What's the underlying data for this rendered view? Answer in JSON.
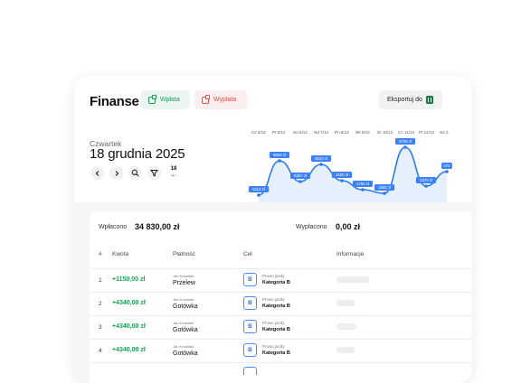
{
  "header": {
    "app_title": "Finanse",
    "btn_in": "Wpłata",
    "btn_out": "Wypłata",
    "btn_export": "Eksportuj do",
    "export_icon": "excel-icon"
  },
  "date_block": {
    "weekday": "Czwartek",
    "date": "18 grudnia 2025",
    "calendar_day": "18",
    "calendar_sub": "gru"
  },
  "controls": {
    "prev_icon": "chevron-left-icon",
    "next_icon": "chevron-right-icon",
    "search_icon": "search-icon",
    "filter_icon": "filter-icon"
  },
  "chart_data": {
    "type": "area",
    "categories": [
      "Cz 4/12",
      "Pt 5/12",
      "So 6/12",
      "Nd 7/12",
      "Pn 8/12",
      "Wt 9/12",
      "Śr 10/12",
      "Cz 11/12",
      "Pt 12/12",
      "So 1"
    ],
    "labels": [
      "6112 zł",
      "6830 zł",
      "5357 zł",
      "6510 zł",
      "2100 zł",
      "1765 zł",
      "1683 zł",
      "8706 zł",
      "2370 zł",
      "472"
    ],
    "colors": {
      "line": "#2f7be5",
      "fill": "#e6effc",
      "label_bg": "#3b82f6"
    }
  },
  "summary": {
    "in_label": "Wpłacono",
    "in_value": "34 830,00 zł",
    "out_label": "Wypłacono",
    "out_value": "0,00 zł"
  },
  "table": {
    "columns": [
      "#",
      "Kwota",
      "Płatność",
      "Cel",
      "Informacje"
    ],
    "rows": [
      {
        "num": "1",
        "amount": "+1150,00 zł",
        "who": "Jan Kowalski",
        "method": "Przelew",
        "badge": "B",
        "cat_top": "Prowo jazdy",
        "cat": "Kategoria B"
      },
      {
        "num": "2",
        "amount": "+4340,00 zł",
        "who": "Jan Kowalski",
        "method": "Gotówka",
        "badge": "B",
        "cat_top": "Prowo jazdy",
        "cat": "Kategoria B"
      },
      {
        "num": "3",
        "amount": "+4340,00 zł",
        "who": "Jan Kowalski",
        "method": "Gotówka",
        "badge": "B",
        "cat_top": "Prowo jazdy",
        "cat": "Kategoria B"
      },
      {
        "num": "4",
        "amount": "+4340,00 zł",
        "who": "Jan Kowalski",
        "method": "Gotówka",
        "badge": "B",
        "cat_top": "Prowo jazdy",
        "cat": "Kategoria B"
      }
    ]
  }
}
